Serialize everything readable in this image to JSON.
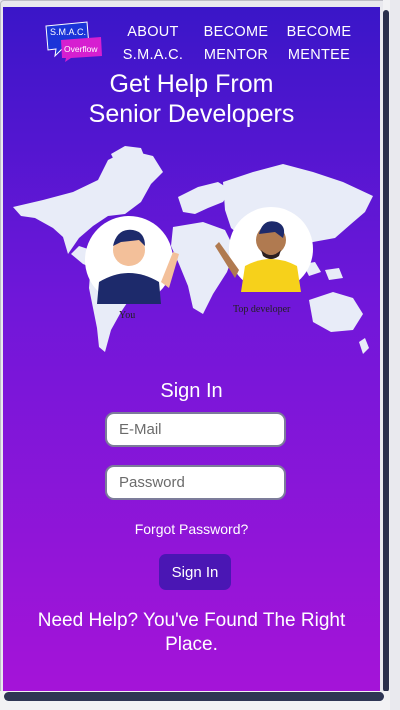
{
  "header": {
    "logo": {
      "line1": "S.M.A.C.",
      "line2": "Overflow"
    },
    "nav": [
      {
        "line1": "ABOUT",
        "line2": "S.M.A.C."
      },
      {
        "line1": "BECOME",
        "line2": "MENTOR"
      },
      {
        "line1": "BECOME",
        "line2": "MENTEE"
      }
    ]
  },
  "hero": {
    "title_line1": "Get Help From",
    "title_line2": "Senior Developers",
    "caption_you": "You",
    "caption_top": "Top developer"
  },
  "signin": {
    "heading": "Sign In",
    "email_placeholder": "E-Mail",
    "email_value": "",
    "password_placeholder": "Password",
    "password_value": "",
    "forgot_label": "Forgot Password?",
    "button_label": "Sign In"
  },
  "footer": {
    "text": "Need Help? You've Found The Right Place."
  },
  "colors": {
    "gradient_top": "#3a16c8",
    "gradient_bottom": "#a514d8",
    "button": "#4a16b4",
    "map_land": "#e8ecf8"
  },
  "icons": [
    "logo-icon",
    "world-map-icon",
    "you-avatar-icon",
    "top-developer-avatar-icon"
  ]
}
